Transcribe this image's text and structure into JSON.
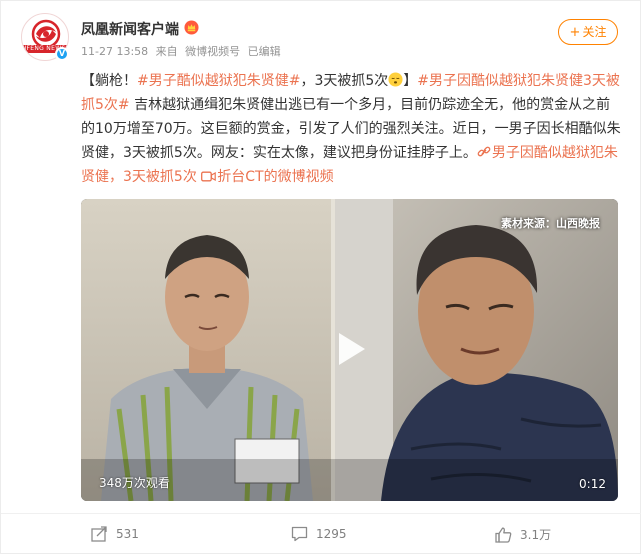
{
  "author": {
    "name": "凤凰新闻客户端",
    "avatar_text": "IFENG NEWS",
    "verified": true
  },
  "meta": {
    "time": "11-27 13:58",
    "from_label": "来自",
    "source": "微博视频号",
    "edited": "已编辑"
  },
  "follow_label": "关注",
  "post": {
    "p1": "【躺枪！",
    "topic1": "#男子酷似越狱犯朱贤健#",
    "p2": "，3天被抓5次",
    "p3": "】",
    "topic2": "#男子因酷似越狱犯朱贤健3天被抓5次#",
    "p4": " 吉林越狱通缉犯朱贤健出逃已有一个多月，目前仍踪迹全无，他的赏金从之前的10万增至70万。这巨额的赏金，引发了人们的强烈关注。近日，一男子因长相酷似朱贤健，3天被抓5次。网友：实在太像，建议把身份证挂脖子上。",
    "link_text": "男子因酷似越狱犯朱贤健，3天被抓5次",
    "video_link_text": "折台CT的微博视频"
  },
  "video": {
    "views": "348万次观看",
    "duration": "0:12",
    "source_tag": "素材来源：山西晚报"
  },
  "actions": {
    "share": "531",
    "comment": "1295",
    "like": "3.1万"
  },
  "colors": {
    "accent": "#ff8200",
    "link": "#eb7350",
    "brand_red": "#d7252b"
  }
}
